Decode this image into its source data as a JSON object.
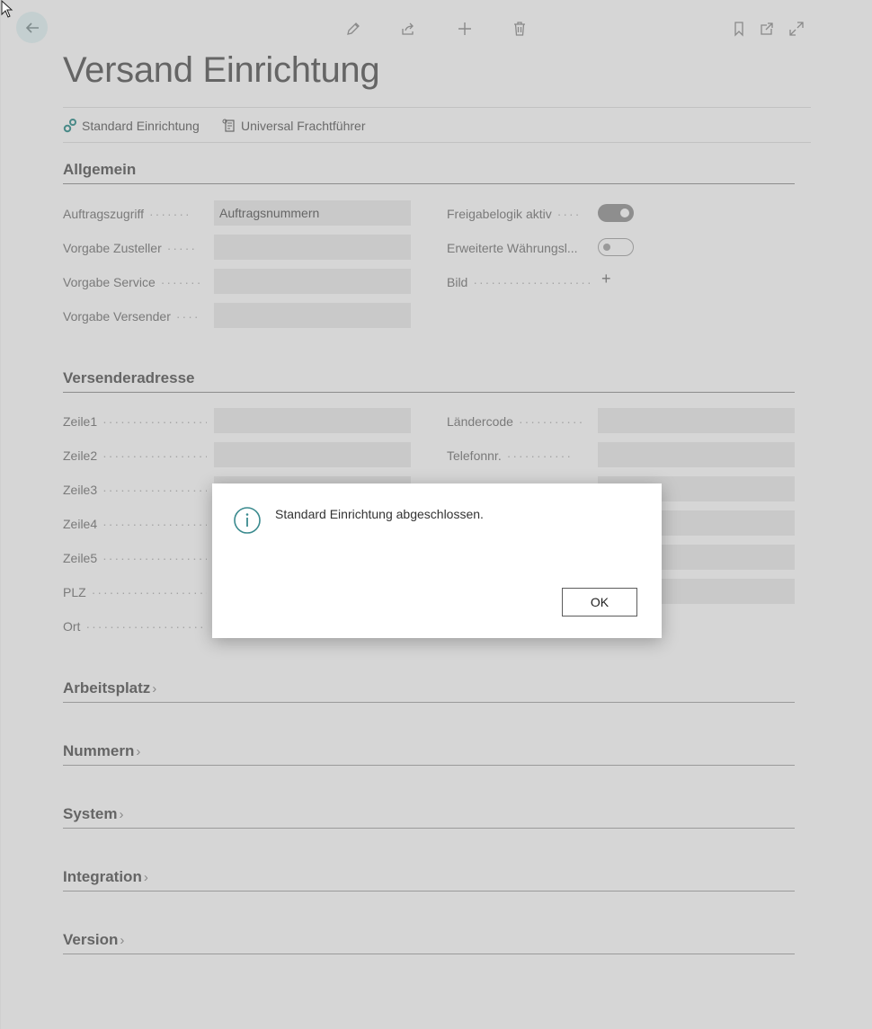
{
  "page": {
    "title": "Versand Einrichtung"
  },
  "toolbar": {
    "icons": [
      "pencil-icon",
      "share-icon",
      "plus-icon",
      "trash-icon",
      "bookmark-icon",
      "open-new-window-icon",
      "expand-icon"
    ]
  },
  "actions": {
    "standard_setup": "Standard Einrichtung",
    "universal_carrier": "Universal Frachtführer"
  },
  "sections": {
    "general": {
      "title": "Allgemein",
      "order_access_label": "Auftragszugriff",
      "order_access_value": "Auftragsnummern",
      "default_deliverer_label": "Vorgabe Zusteller",
      "default_deliverer_value": "",
      "default_service_label": "Vorgabe Service",
      "default_service_value": "",
      "default_sender_label": "Vorgabe Versender",
      "default_sender_value": "",
      "release_logic_label": "Freigabelogik aktiv",
      "release_logic_on": true,
      "extended_currency_label": "Erweiterte Währungsl...",
      "extended_currency_on": false,
      "image_label": "Bild",
      "image_add": "+"
    },
    "sender_address": {
      "title": "Versenderadresse",
      "line1_label": "Zeile1",
      "line2_label": "Zeile2",
      "line3_label": "Zeile3",
      "line4_label": "Zeile4",
      "line5_label": "Zeile5",
      "zip_label": "PLZ",
      "city_label": "Ort",
      "country_label": "Ländercode",
      "phone_label": "Telefonnr."
    },
    "workplace": {
      "title": "Arbeitsplatz"
    },
    "numbers": {
      "title": "Nummern"
    },
    "system": {
      "title": "System"
    },
    "integration": {
      "title": "Integration"
    },
    "version": {
      "title": "Version"
    },
    "chevron": "›"
  },
  "dialog": {
    "message": "Standard Einrichtung abgeschlossen.",
    "ok_label": "OK"
  },
  "colors": {
    "overlay_bg": "#d6d6d6",
    "dialog_icon": "#3a8a8e"
  }
}
